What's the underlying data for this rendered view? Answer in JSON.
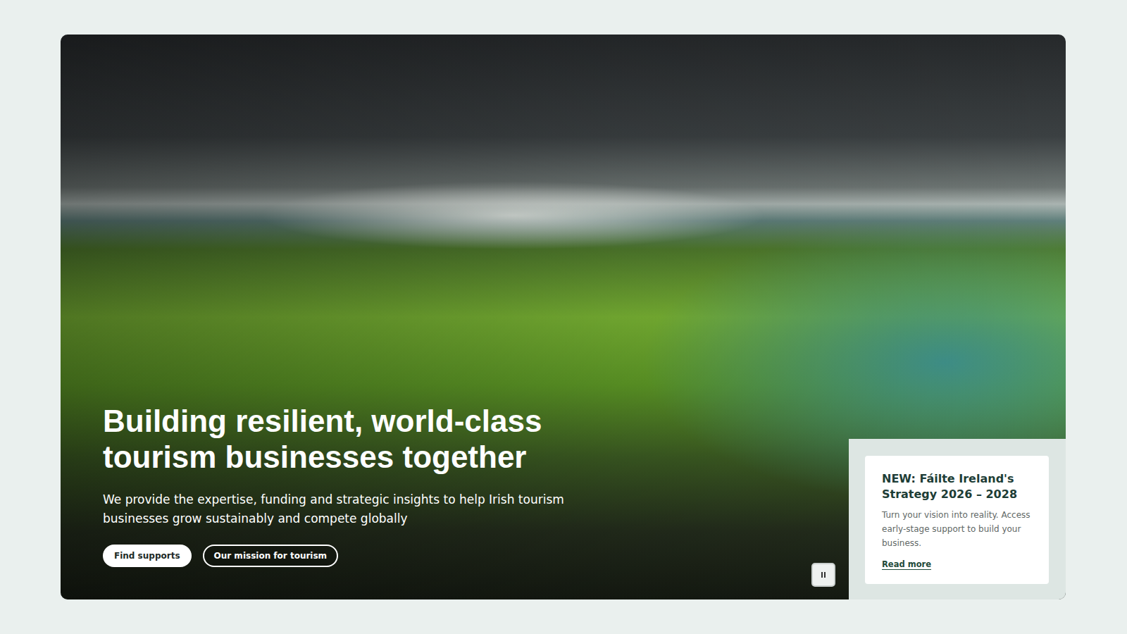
{
  "hero": {
    "heading": "Building resilient, world-class tourism businesses together",
    "text": "We provide the expertise, funding and strategic insights to help Irish tourism businesses grow sustainably and compete globally",
    "buttons": [
      {
        "label": "Find supports",
        "kind": "filled"
      },
      {
        "label": "Our mission for tourism",
        "kind": "outline"
      }
    ],
    "video": {
      "playing": true
    }
  },
  "news_card": {
    "title": "NEW: Fáilte Ireland's Strategy 2026 – 2028",
    "text": "Turn your vision into reality. Access early-stage support to build your business.",
    "link": "Read more"
  }
}
